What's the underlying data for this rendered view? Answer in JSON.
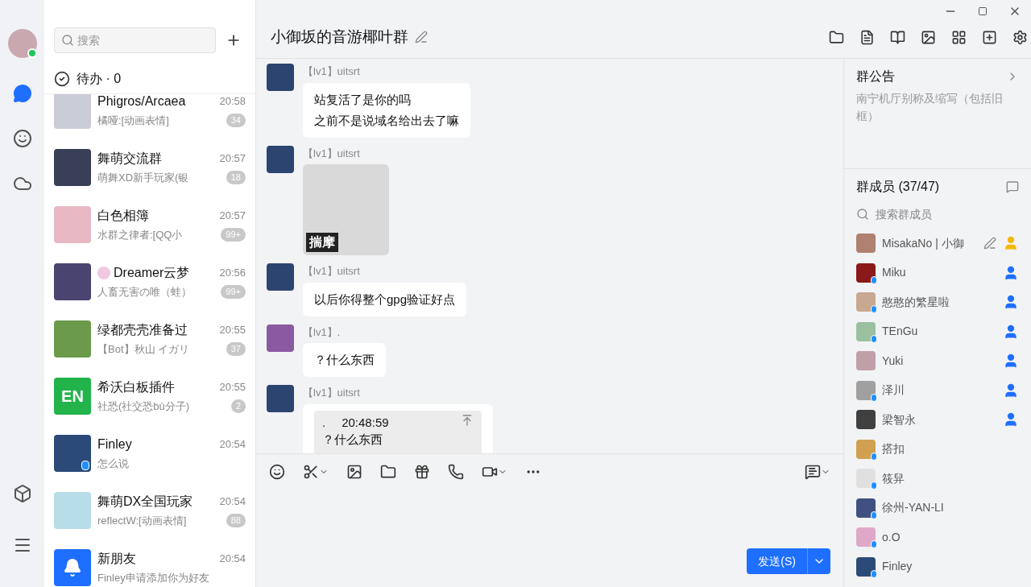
{
  "rail": {
    "online": true,
    "items": [
      {
        "kind": "chat",
        "selected": true
      },
      {
        "kind": "contacts",
        "selected": false
      },
      {
        "kind": "cloud",
        "selected": false
      }
    ]
  },
  "search": {
    "placeholder": "搜索"
  },
  "todo": "待办 · 0",
  "chats": [
    {
      "name": "Phigros/Arcaea",
      "preview": "橘哑:[动画表情]",
      "time": "20:58",
      "unread": "34",
      "mobile": false,
      "color": "#c9ccd6"
    },
    {
      "name": "舞萌交流群",
      "preview": "萌舞XD新手玩家(银",
      "time": "20:57",
      "unread": "18",
      "mobile": false,
      "color": "#3a3f58"
    },
    {
      "name": "白色相簿",
      "preview": "水群之律者:[QQ小",
      "time": "20:57",
      "unread": "99+",
      "mobile": false,
      "color": "#e8b9c4"
    },
    {
      "name": "Dreamer云梦",
      "preview": "人畜无害の唯（蛙）",
      "time": "20:56",
      "unread": "99+",
      "mobile": false,
      "color": "#4a4570",
      "emblem": true
    },
    {
      "name": "绿都壳壳准备过",
      "preview": "【Bot】秋山 イガリ",
      "time": "20:55",
      "unread": "37",
      "mobile": false,
      "color": "#6a9a4a"
    },
    {
      "name": "希沃白板插件",
      "preview": "社恐(社交恐bù分子)",
      "time": "20:55",
      "unread": "2",
      "mobile": false,
      "color": "#22b34a",
      "logo": "EN"
    },
    {
      "name": "Finley",
      "preview": "怎么说",
      "time": "20:54",
      "mobile": true,
      "color": "#2c4a78"
    },
    {
      "name": "舞萌DX全国玩家",
      "preview": "reflectW:[动画表情]",
      "time": "20:54",
      "unread": "88",
      "mobile": false,
      "color": "#b6dde8"
    },
    {
      "name": "新朋友",
      "preview": "Finley申请添加你为好友",
      "time": "20:54",
      "mobile": false,
      "color": "#1e6fff",
      "bell": true
    }
  ],
  "chat": {
    "title": "小御坂的音游椰叶群",
    "messages": [
      {
        "kind": "text",
        "sender": "【lv1】uitsrt",
        "lines": [
          "站复活了是你的吗",
          "之前不是说域名给出去了嘛"
        ],
        "color": "#2c4470"
      },
      {
        "kind": "image",
        "sender": "【lv1】uitsrt",
        "caption": "揣摩",
        "color": "#2c4470"
      },
      {
        "kind": "text",
        "sender": "【lv1】uitsrt",
        "lines": [
          "以后你得整个gpg验证好点"
        ],
        "color": "#2c4470"
      },
      {
        "kind": "text",
        "sender": "【lv1】.",
        "lines": [
          "？什么东西"
        ],
        "color": "#8a5aa0"
      },
      {
        "kind": "quote",
        "sender": "【lv1】uitsrt",
        "quote_author": ".",
        "quote_time": "20:48:59",
        "quote_text": "？什么东西",
        "color": "#2c4470"
      }
    ],
    "send": "发送(S)"
  },
  "notice": {
    "title": "群公告",
    "text": "南宁机厅别称及缩写（包括旧框）"
  },
  "members": {
    "title": "群成员 (37/47)",
    "search_placeholder": "搜索群成员",
    "list": [
      {
        "name": "MisakaNo | 小御",
        "kind": "owner",
        "mobile": false,
        "editable": true,
        "color": "#b08070"
      },
      {
        "name": "Miku",
        "kind": "admin",
        "mobile": true,
        "color": "#8a1a1a"
      },
      {
        "name": "憨憨的繁星啦",
        "kind": "admin",
        "mobile": true,
        "color": "#c8a890"
      },
      {
        "name": "TEnGu",
        "kind": "admin",
        "mobile": true,
        "color": "#9ac0a0"
      },
      {
        "name": "Yuki",
        "kind": "admin",
        "mobile": false,
        "color": "#c0a0a8"
      },
      {
        "name": "泽川",
        "kind": "admin",
        "mobile": true,
        "color": "#a0a0a0"
      },
      {
        "name": "梁智永",
        "kind": "admin",
        "mobile": false,
        "color": "#404040"
      },
      {
        "name": "搭扣",
        "kind": "member",
        "mobile": true,
        "color": "#d0a050"
      },
      {
        "name": "筱舁",
        "kind": "member",
        "mobile": true,
        "color": "#e0e0e0"
      },
      {
        "name": "徐州-YAN-LI",
        "kind": "member",
        "mobile": true,
        "color": "#405080"
      },
      {
        "name": "o.O",
        "kind": "member",
        "mobile": true,
        "color": "#e0a8c8"
      },
      {
        "name": "Finley",
        "kind": "member",
        "mobile": true,
        "color": "#2c4a78"
      }
    ]
  }
}
